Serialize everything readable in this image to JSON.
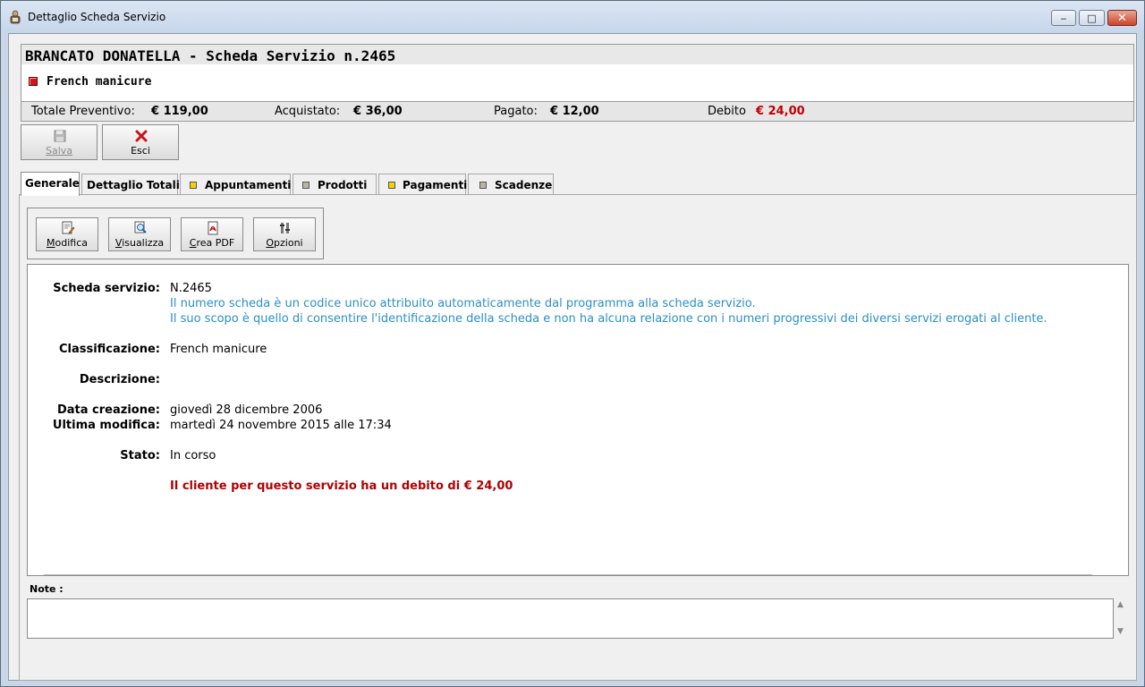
{
  "window": {
    "title": "Dettaglio Scheda Servizio",
    "minimize_glyph": "‒",
    "maximize_glyph": "□",
    "close_glyph": "✕"
  },
  "header": {
    "client_title": "BRANCATO DONATELLA - Scheda Servizio n.2465",
    "classification": "French manicure",
    "classification_color": "#d01818",
    "totals": [
      {
        "label": "Totale Preventivo:",
        "value": "€ 119,00"
      },
      {
        "label": "Acquistato:",
        "value": "€ 36,00"
      },
      {
        "label": "Pagato:",
        "value": "€ 12,00"
      },
      {
        "label": "Debito",
        "value": "€ 24,00",
        "color": "#c00000"
      }
    ]
  },
  "toolbar": {
    "save_label": "Salva",
    "save_icon": "floppy-icon",
    "exit_label": "Esci",
    "exit_icon": "red-x-icon"
  },
  "tabs": [
    {
      "label": "Generale",
      "active": true
    },
    {
      "label": "Dettaglio Totali"
    },
    {
      "label": "Appuntamenti",
      "marker": "#f5d100"
    },
    {
      "label": "Prodotti",
      "marker": "#b9b6a4"
    },
    {
      "label": "Pagamenti",
      "marker": "#f5d100"
    },
    {
      "label": "Scadenze",
      "marker": "#b9b6a4"
    }
  ],
  "inner_toolbar": {
    "modifica": "Modifica",
    "visualizza": "Visualizza",
    "crea_pdf": "Crea PDF",
    "opzioni": "Opzioni"
  },
  "detail": {
    "scheda_label": "Scheda servizio:",
    "scheda_value": "N.2465",
    "scheda_note_1": "Il numero scheda è un codice unico attribuito automaticamente dal programma alla scheda servizio.",
    "scheda_note_2": "Il suo scopo è quello di consentire l'identificazione della scheda e non ha alcuna relazione con i numeri progressivi dei diversi servizi erogati al cliente.",
    "classificazione_label": "Classificazione:",
    "classificazione_value": "French manicure",
    "descrizione_label": "Descrizione:",
    "data_creazione_label": "Data creazione:",
    "data_creazione_value": "giovedì 28 dicembre 2006",
    "ultima_modifica_label": "Ultima modifica:",
    "ultima_modifica_value": "martedì 24 novembre 2015 alle 17:34",
    "stato_label": "Stato:",
    "stato_value": "In corso",
    "debt_warning": "Il cliente per questo servizio ha un debito di € 24,00"
  },
  "note": {
    "label": "Note :"
  }
}
